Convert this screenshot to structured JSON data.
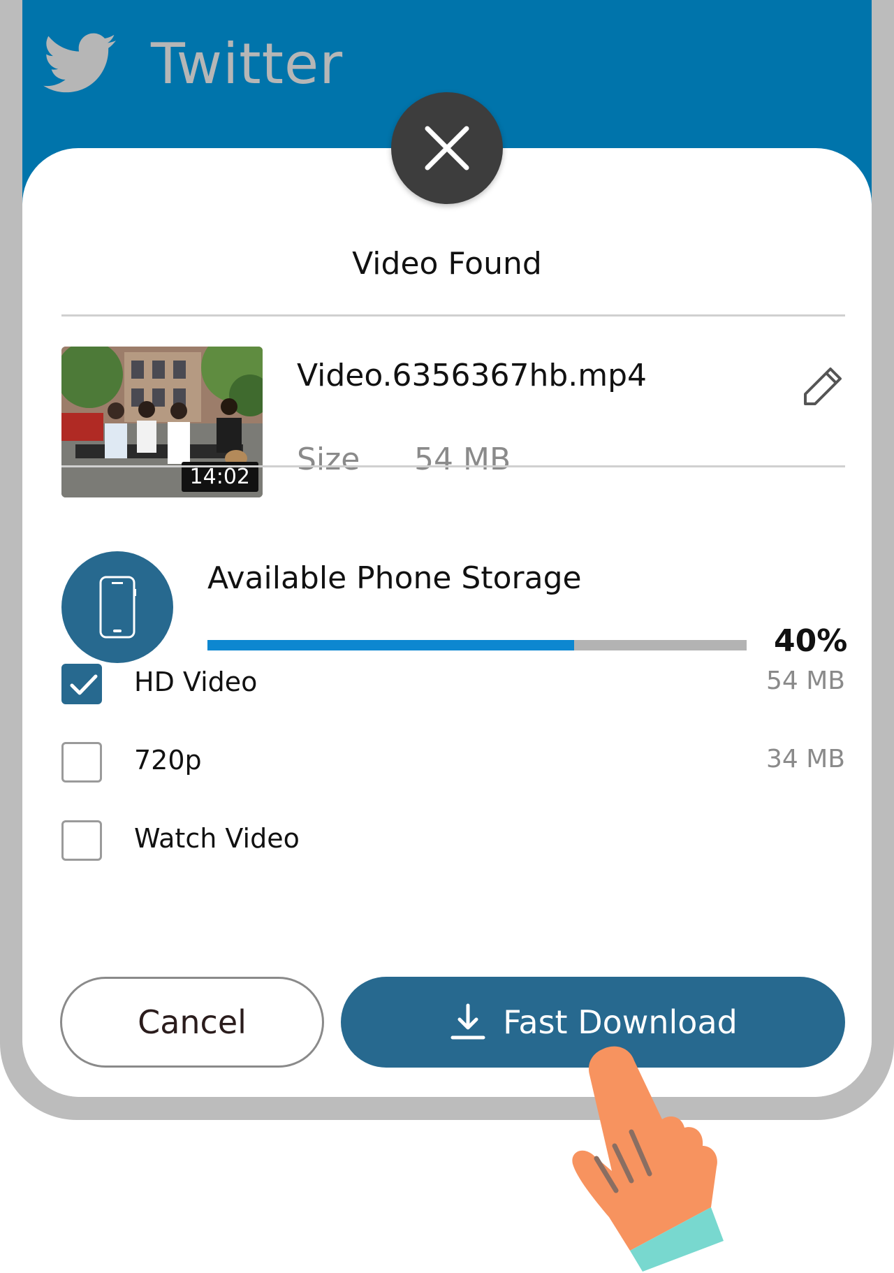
{
  "header": {
    "app_title": "Twitter",
    "icon": "twitter-bird-icon",
    "bg_color": "#0074ab"
  },
  "dialog": {
    "title": "Video Found",
    "close_icon": "close-icon",
    "file": {
      "name": "Video.6356367hb.mp4",
      "duration": "14:02",
      "size_label": "Size",
      "size_value": "54 MB"
    },
    "storage": {
      "title": "Available Phone Storage",
      "percent_label": "40%",
      "used_fraction": 0.68,
      "icon": "phone-icon"
    },
    "options": [
      {
        "label": "HD Video",
        "size": "54 MB",
        "checked": true
      },
      {
        "label": "720p",
        "size": "34 MB",
        "checked": false
      },
      {
        "label": "Watch Video",
        "size": "",
        "checked": false
      }
    ],
    "buttons": {
      "cancel": "Cancel",
      "download": "Fast Download"
    },
    "accent_color": "#27698f"
  }
}
